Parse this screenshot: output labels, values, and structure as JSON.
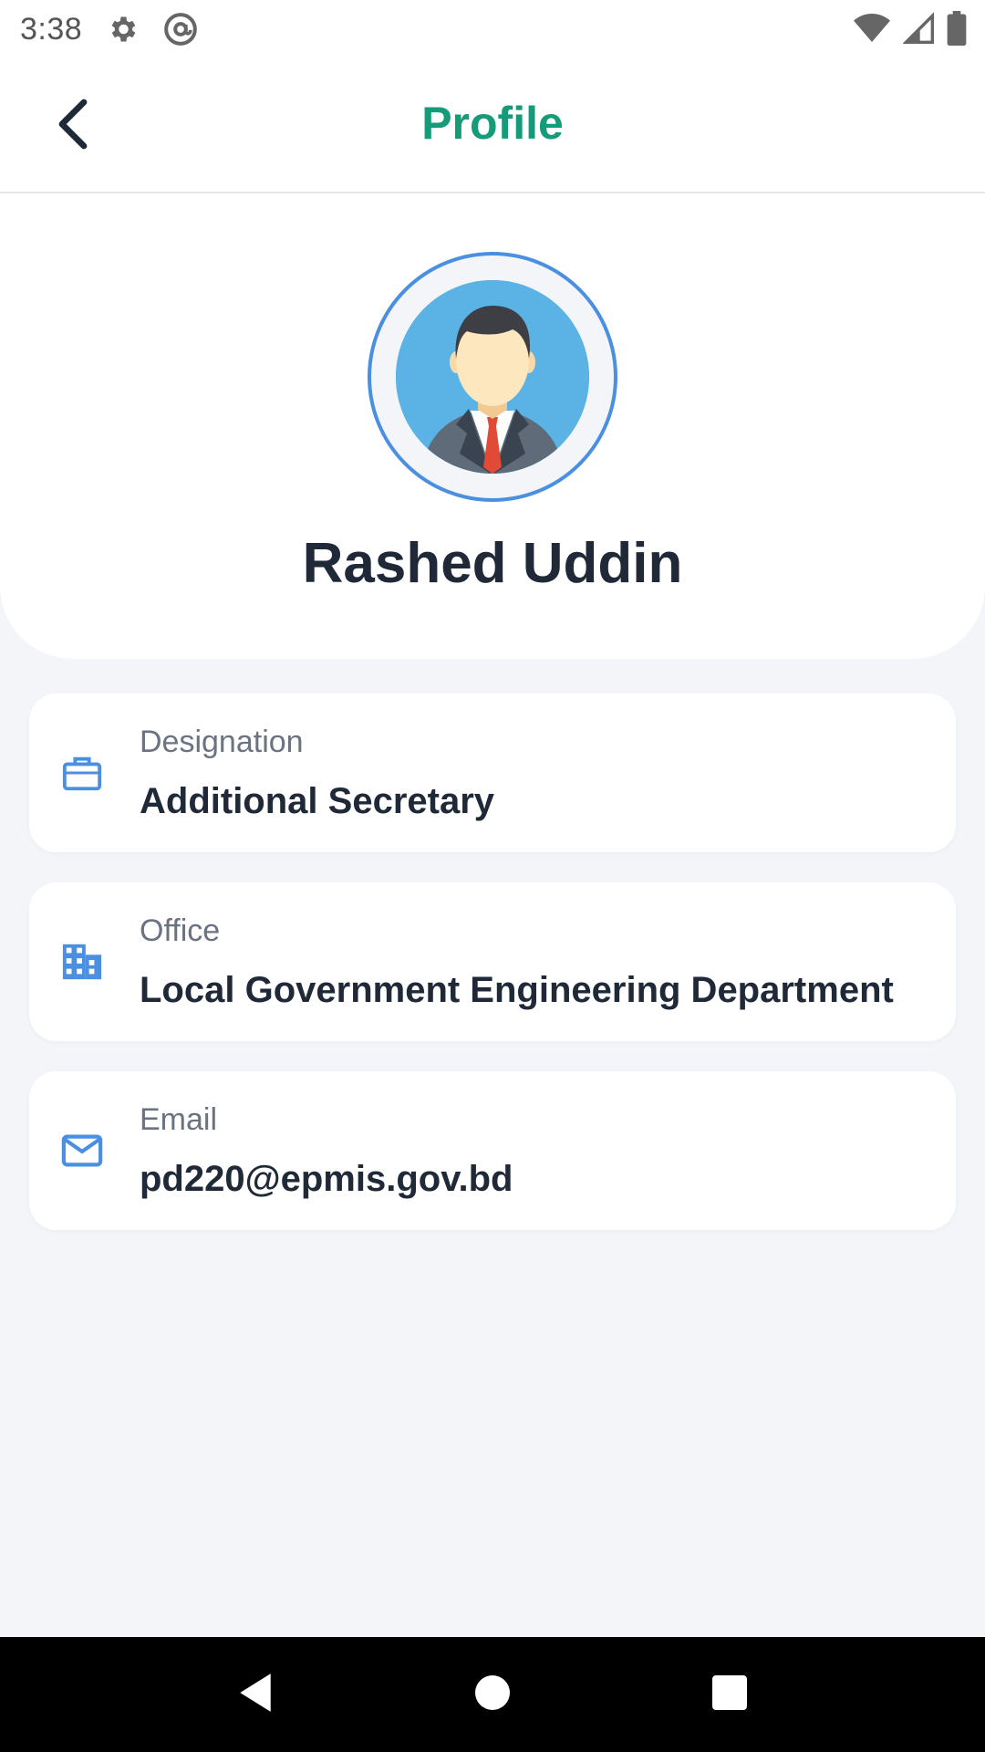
{
  "status_bar": {
    "time": "3:38",
    "icons": [
      "settings-icon",
      "at-sign-icon",
      "wifi-icon",
      "signal-icon",
      "battery-icon"
    ]
  },
  "app_bar": {
    "title": "Profile",
    "back_icon": "chevron-left-icon"
  },
  "profile": {
    "name": "Rashed Uddin",
    "avatar": "businessman-avatar"
  },
  "details": [
    {
      "icon": "briefcase-icon",
      "label": "Designation",
      "value": "Additional Secretary"
    },
    {
      "icon": "building-icon",
      "label": "Office",
      "value": "Local Government Engineering Department"
    },
    {
      "icon": "mail-icon",
      "label": "Email",
      "value": "pd220@epmis.gov.bd"
    }
  ],
  "nav_bar": {
    "buttons": [
      "back-triangle-icon",
      "home-circle-icon",
      "recents-square-icon"
    ]
  },
  "colors": {
    "accent": "#159a7a",
    "icon_blue": "#4a8fe0",
    "background": "#f3f5f9",
    "text_dark": "#1f2937",
    "text_muted": "#6b7280"
  }
}
